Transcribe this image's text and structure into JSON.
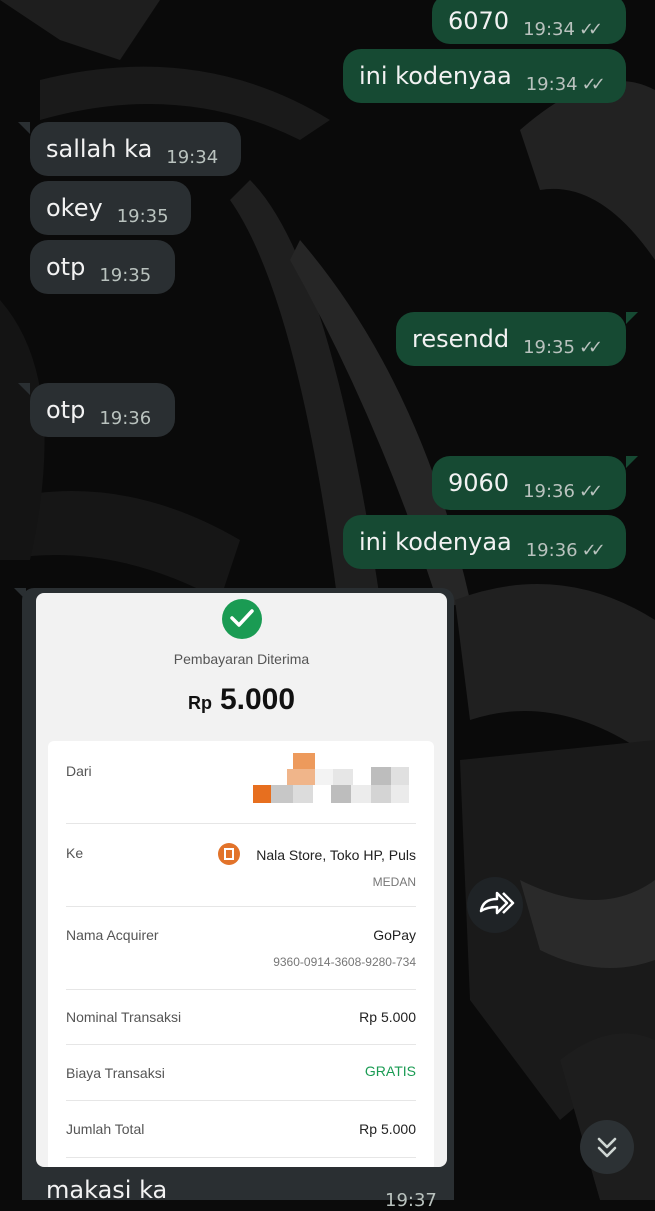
{
  "messages": [
    {
      "dir": "out",
      "text": "6070",
      "time": "19:34",
      "ticks": "✓✓"
    },
    {
      "dir": "out",
      "text": "ini kodenyaa",
      "time": "19:34",
      "ticks": "✓✓"
    },
    {
      "dir": "in",
      "text": "sallah ka",
      "time": "19:34"
    },
    {
      "dir": "in",
      "text": "okey",
      "time": "19:35"
    },
    {
      "dir": "in",
      "text": "otp",
      "time": "19:35"
    },
    {
      "dir": "out",
      "text": "resendd",
      "time": "19:35",
      "ticks": "✓✓"
    },
    {
      "dir": "in",
      "text": "otp",
      "time": "19:36"
    },
    {
      "dir": "out",
      "text": "9060",
      "time": "19:36",
      "ticks": "✓✓"
    },
    {
      "dir": "out",
      "text": "ini kodenyaa",
      "time": "19:36",
      "ticks": "✓✓"
    }
  ],
  "receipt": {
    "status": "Pembayaran Diterima",
    "currency": "Rp",
    "amount": "5.000",
    "rows": {
      "dari": {
        "label": "Dari"
      },
      "ke": {
        "label": "Ke",
        "value": "Nala Store, Toko HP, Puls",
        "sub": "MEDAN"
      },
      "acquirer": {
        "label": "Nama Acquirer",
        "value": "GoPay",
        "sub": "9360-0914-3608-9280-734"
      },
      "nominal": {
        "label": "Nominal Transaksi",
        "value": "Rp 5.000"
      },
      "biaya": {
        "label": "Biaya Transaksi",
        "value": "GRATIS"
      },
      "total": {
        "label": "Jumlah Total",
        "value": "Rp 5.000"
      }
    },
    "colors": {
      "success": "#1a9b53",
      "free": "#1a9b53",
      "store_icon": "#e2732a"
    }
  },
  "last_message": {
    "text": "makasi ka",
    "time": "19:37"
  },
  "icons": {
    "forward": "forward-icon",
    "scroll_down": "double-chevron-down-icon"
  },
  "colors": {
    "incoming": "#2a2f32",
    "outgoing": "#164a33"
  }
}
